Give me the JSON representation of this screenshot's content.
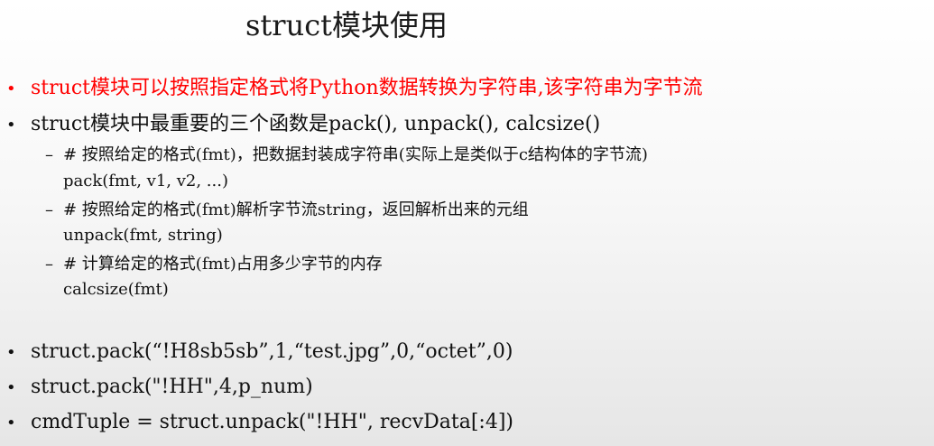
{
  "slide": {
    "title": "struct模块使用",
    "bullet_glyph": "•",
    "dash_glyph": "–",
    "bullets": [
      {
        "text": "struct模块可以按照指定格式将Python数据转换为字符串,该字符串为字节流",
        "color": "#ff0000"
      },
      {
        "text": "struct模块中最重要的三个函数是pack(), unpack(), calcsize()",
        "color": "#111111"
      }
    ],
    "sub_items": [
      {
        "text": "# 按照给定的格式(fmt)，把数据封装成字符串(实际上是类似于c结构体的字节流)",
        "code": "pack(fmt, v1, v2, ...)"
      },
      {
        "text": "# 按照给定的格式(fmt)解析字节流string，返回解析出来的元组",
        "code": "unpack(fmt, string)"
      },
      {
        "text": "# 计算给定的格式(fmt)占用多少字节的内存",
        "code": "calcsize(fmt)"
      }
    ],
    "examples": [
      "struct.pack(“!H8sb5sb”,1,“test.jpg”,0,“octet”,0)",
      "struct.pack(\"!HH\",4,p_num)",
      "cmdTuple = struct.unpack(\"!HH\", recvData[:4])"
    ]
  }
}
